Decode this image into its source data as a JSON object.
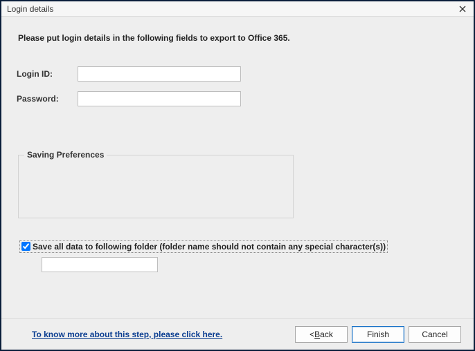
{
  "window": {
    "title": "Login details"
  },
  "instruction": "Please put login details in the following fields to export to Office 365.",
  "form": {
    "login_label": "Login ID:",
    "login_value": "",
    "password_label": "Password:",
    "password_value": ""
  },
  "preferences": {
    "legend": "Saving Preferences"
  },
  "save": {
    "checkbox_label": "Save all data to following folder (folder name should not contain any special character(s))",
    "checked": true,
    "folder_value": ""
  },
  "footer": {
    "help_link": "To know more about this step, please click here.",
    "back_prefix": "< ",
    "back_char": "B",
    "back_suffix": "ack",
    "finish_label": "Finish",
    "cancel_label": "Cancel"
  }
}
